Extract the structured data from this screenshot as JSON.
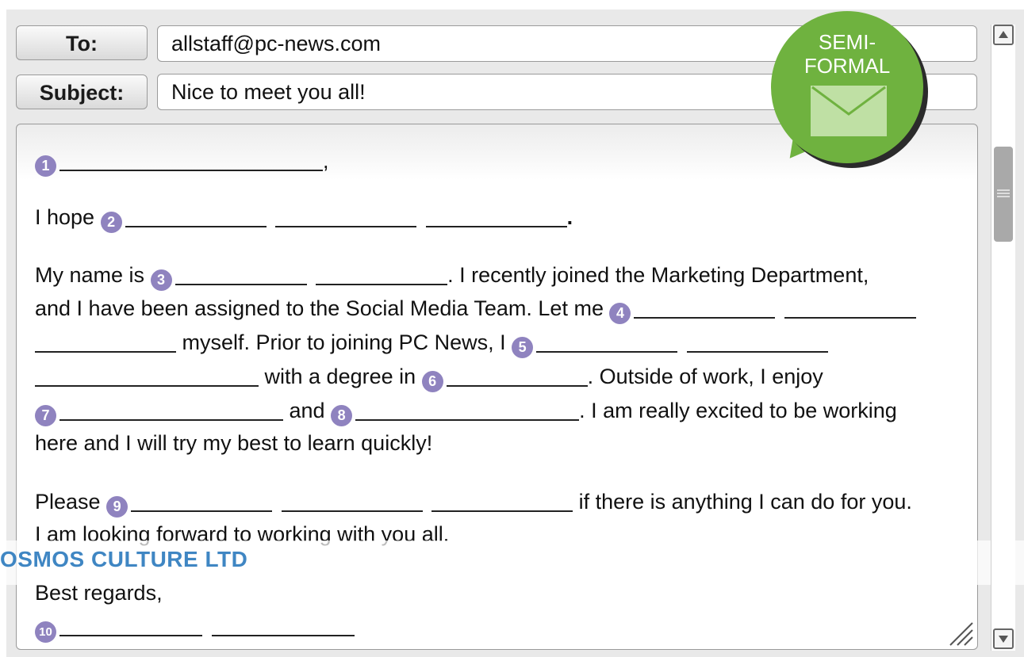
{
  "header": {
    "to_label": "To:",
    "to_value": "allstaff@pc-news.com",
    "subject_label": "Subject:",
    "subject_value": "Nice to meet you all!"
  },
  "badge": {
    "line1": "SEMI-",
    "line2": "FORMAL",
    "icon": "envelope-icon",
    "color": "#6fb23f"
  },
  "body": {
    "n1": "1",
    "n2": "2",
    "n3": "3",
    "n4": "4",
    "n5": "5",
    "n6": "6",
    "n7": "7",
    "n8": "8",
    "n9": "9",
    "n10": "10",
    "comma": ",",
    "hope": "I hope",
    "period": ".",
    "myname": "My name is",
    "recently": ". I recently joined the Marketing Department,",
    "assigned": "and I have been assigned to the Social Media Team. Let me",
    "myself": "myself. Prior to joining PC News, I",
    "degree": "with a degree in",
    "outside": ". Outside of work, I enjoy",
    "and": "and",
    "excited": ". I am really excited to be working",
    "here": "here and I will try my best to learn quickly!",
    "please": "Please",
    "ifthere": "if there is anything I can do for you.",
    "looking": "I am looking forward to working with you all.",
    "regards": "Best regards,"
  },
  "watermark": "OSMOS CULTURE LTD",
  "icons": {
    "scroll_up": "triangle-up-icon",
    "scroll_down": "triangle-down-icon",
    "resize": "resize-grip-icon",
    "badge_color": "#8f83bf"
  }
}
